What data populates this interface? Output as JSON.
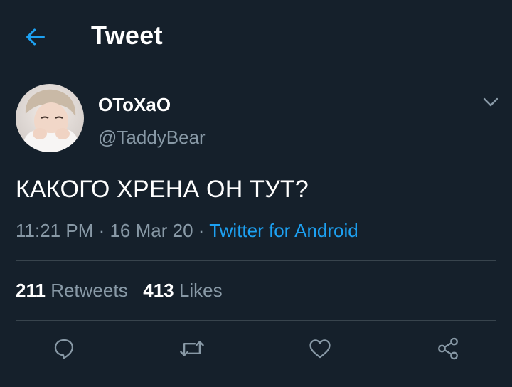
{
  "header": {
    "title": "Tweet",
    "back_icon": "arrow-left-icon"
  },
  "tweet": {
    "author": {
      "display_name": "OToXaO",
      "handle": "@TaddyBear",
      "avatar_icon": "user-avatar"
    },
    "text": "КАКОГО ХРЕНА ОН ТУТ?",
    "time": "11:21 PM",
    "separator": " · ",
    "date": "16 Mar 20",
    "source": "Twitter for Android",
    "retweets": {
      "count": "211",
      "label": "Retweets"
    },
    "likes": {
      "count": "413",
      "label": "Likes"
    }
  },
  "actions": [
    {
      "icon": "reply-icon"
    },
    {
      "icon": "retweet-icon"
    },
    {
      "icon": "like-heart-icon"
    },
    {
      "icon": "share-icon"
    }
  ],
  "colors": {
    "background": "#15202b",
    "accent": "#1da1f2",
    "muted_text": "#8899a6",
    "divider": "#38444d"
  }
}
